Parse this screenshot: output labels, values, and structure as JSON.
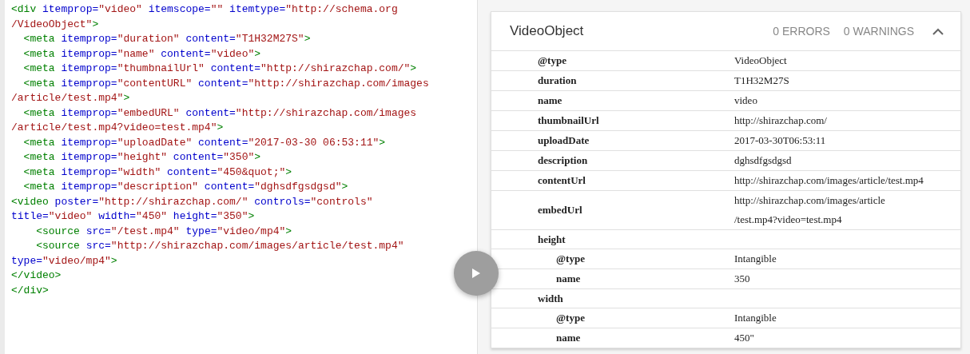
{
  "code_lines": [
    [
      {
        "kind": "tag",
        "text": "<div"
      },
      {
        "kind": "attr",
        "text": " itemprop="
      },
      {
        "kind": "string",
        "text": "\"video\""
      },
      {
        "kind": "attr",
        "text": " itemscope="
      },
      {
        "kind": "string",
        "text": "\"\""
      },
      {
        "kind": "attr",
        "text": " itemtype="
      },
      {
        "kind": "string",
        "text": "\"http://schema.org"
      }
    ],
    [
      {
        "kind": "string",
        "text": "/VideoObject\""
      },
      {
        "kind": "tag",
        "text": ">"
      }
    ],
    [
      {
        "kind": "tag",
        "text": "  <meta"
      },
      {
        "kind": "attr",
        "text": " itemprop="
      },
      {
        "kind": "string",
        "text": "\"duration\""
      },
      {
        "kind": "attr",
        "text": " content="
      },
      {
        "kind": "string",
        "text": "\"T1H32M27S\""
      },
      {
        "kind": "tag",
        "text": ">"
      }
    ],
    [
      {
        "kind": "tag",
        "text": "  <meta"
      },
      {
        "kind": "attr",
        "text": " itemprop="
      },
      {
        "kind": "string",
        "text": "\"name\""
      },
      {
        "kind": "attr",
        "text": " content="
      },
      {
        "kind": "string",
        "text": "\"video\""
      },
      {
        "kind": "tag",
        "text": ">"
      }
    ],
    [
      {
        "kind": "tag",
        "text": "  <meta"
      },
      {
        "kind": "attr",
        "text": " itemprop="
      },
      {
        "kind": "string",
        "text": "\"thumbnailUrl\""
      },
      {
        "kind": "attr",
        "text": " content="
      },
      {
        "kind": "string",
        "text": "\"http://shirazchap.com/\""
      },
      {
        "kind": "tag",
        "text": ">"
      }
    ],
    [
      {
        "kind": "tag",
        "text": "  <meta"
      },
      {
        "kind": "attr",
        "text": " itemprop="
      },
      {
        "kind": "string",
        "text": "\"contentURL\""
      },
      {
        "kind": "attr",
        "text": " content="
      },
      {
        "kind": "string",
        "text": "\"http://shirazchap.com/images"
      }
    ],
    [
      {
        "kind": "string",
        "text": "/article/test.mp4\""
      },
      {
        "kind": "tag",
        "text": ">"
      }
    ],
    [
      {
        "kind": "tag",
        "text": "  <meta"
      },
      {
        "kind": "attr",
        "text": " itemprop="
      },
      {
        "kind": "string",
        "text": "\"embedURL\""
      },
      {
        "kind": "attr",
        "text": " content="
      },
      {
        "kind": "string",
        "text": "\"http://shirazchap.com/images"
      }
    ],
    [
      {
        "kind": "string",
        "text": "/article/test.mp4?video=test.mp4\""
      },
      {
        "kind": "tag",
        "text": ">"
      }
    ],
    [
      {
        "kind": "tag",
        "text": "  <meta"
      },
      {
        "kind": "attr",
        "text": " itemprop="
      },
      {
        "kind": "string",
        "text": "\"uploadDate\""
      },
      {
        "kind": "attr",
        "text": " content="
      },
      {
        "kind": "string",
        "text": "\"2017-03-30 06:53:11\""
      },
      {
        "kind": "tag",
        "text": ">"
      }
    ],
    [
      {
        "kind": "tag",
        "text": "  <meta"
      },
      {
        "kind": "attr",
        "text": " itemprop="
      },
      {
        "kind": "string",
        "text": "\"height\""
      },
      {
        "kind": "attr",
        "text": " content="
      },
      {
        "kind": "string",
        "text": "\"350\""
      },
      {
        "kind": "tag",
        "text": ">"
      }
    ],
    [
      {
        "kind": "tag",
        "text": "  <meta"
      },
      {
        "kind": "attr",
        "text": " itemprop="
      },
      {
        "kind": "string",
        "text": "\"width\""
      },
      {
        "kind": "attr",
        "text": " content="
      },
      {
        "kind": "string",
        "text": "\"450&quot;\""
      },
      {
        "kind": "tag",
        "text": ">"
      }
    ],
    [
      {
        "kind": "tag",
        "text": "  <meta"
      },
      {
        "kind": "attr",
        "text": " itemprop="
      },
      {
        "kind": "string",
        "text": "\"description\""
      },
      {
        "kind": "attr",
        "text": " content="
      },
      {
        "kind": "string",
        "text": "\"dghsdfgsdgsd\""
      },
      {
        "kind": "tag",
        "text": ">"
      }
    ],
    [
      {
        "kind": "tag",
        "text": "<video"
      },
      {
        "kind": "attr",
        "text": " poster="
      },
      {
        "kind": "string",
        "text": "\"http://shirazchap.com/\""
      },
      {
        "kind": "attr",
        "text": " controls="
      },
      {
        "kind": "string",
        "text": "\"controls\""
      }
    ],
    [
      {
        "kind": "attr",
        "text": "title="
      },
      {
        "kind": "string",
        "text": "\"video\""
      },
      {
        "kind": "attr",
        "text": " width="
      },
      {
        "kind": "string",
        "text": "\"450\""
      },
      {
        "kind": "attr",
        "text": " height="
      },
      {
        "kind": "string",
        "text": "\"350\""
      },
      {
        "kind": "tag",
        "text": ">"
      }
    ],
    [
      {
        "kind": "tag",
        "text": "    <source"
      },
      {
        "kind": "attr",
        "text": " src="
      },
      {
        "kind": "string",
        "text": "\"/test.mp4\""
      },
      {
        "kind": "attr",
        "text": " type="
      },
      {
        "kind": "string",
        "text": "\"video/mp4\""
      },
      {
        "kind": "tag",
        "text": ">"
      }
    ],
    [
      {
        "kind": "tag",
        "text": "    <source"
      },
      {
        "kind": "attr",
        "text": " src="
      },
      {
        "kind": "string",
        "text": "\"http://shirazchap.com/images/article/test.mp4\""
      }
    ],
    [
      {
        "kind": "attr",
        "text": "type="
      },
      {
        "kind": "string",
        "text": "\"video/mp4\""
      },
      {
        "kind": "tag",
        "text": ">"
      }
    ],
    [
      {
        "kind": "tag",
        "text": "</video>"
      }
    ],
    [
      {
        "kind": "tag",
        "text": "</div>"
      }
    ]
  ],
  "result": {
    "title": "VideoObject",
    "errors": "0 ERRORS",
    "warnings": "0 WARNINGS",
    "expanded": true,
    "properties": [
      {
        "key": "@type",
        "value": "VideoObject"
      },
      {
        "key": "duration",
        "value": "T1H32M27S"
      },
      {
        "key": "name",
        "value": "video"
      },
      {
        "key": "thumbnailUrl",
        "value": "http://shirazchap.com/"
      },
      {
        "key": "uploadDate",
        "value": "2017-03-30T06:53:11"
      },
      {
        "key": "description",
        "value": "dghsdfgsdgsd"
      },
      {
        "key": "contentUrl",
        "value": "http://shirazchap.com/images/article/test.mp4"
      },
      {
        "key": "embedUrl",
        "value": [
          "http://shirazchap.com/images/article",
          "/test.mp4?video=test.mp4"
        ]
      },
      {
        "key": "height",
        "children": [
          {
            "key": "@type",
            "value": "Intangible"
          },
          {
            "key": "name",
            "value": "350"
          }
        ]
      },
      {
        "key": "width",
        "children": [
          {
            "key": "@type",
            "value": "Intangible"
          },
          {
            "key": "name",
            "value": "450\""
          }
        ]
      }
    ]
  }
}
